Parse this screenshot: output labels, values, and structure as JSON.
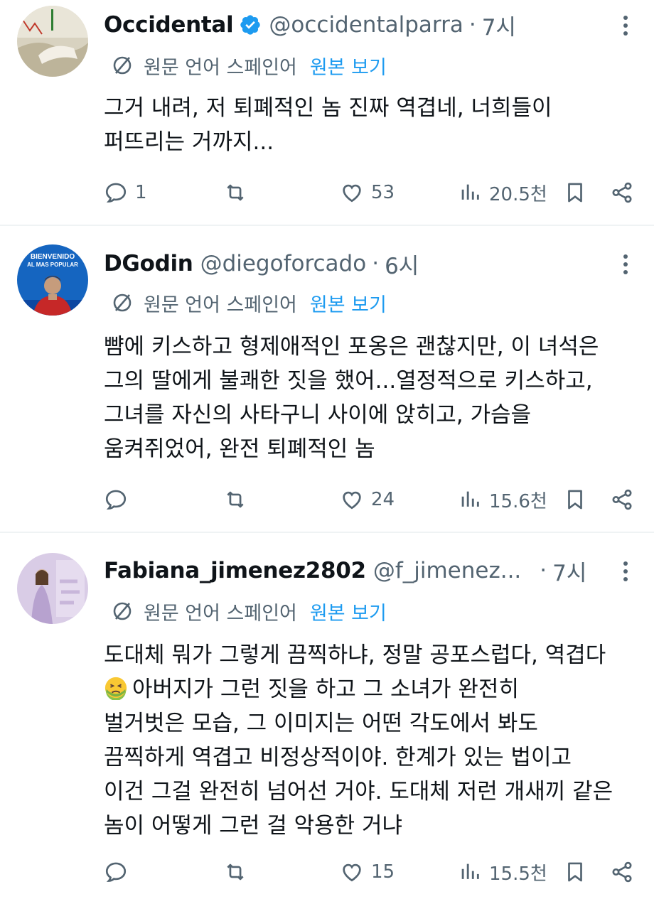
{
  "translate": {
    "label": "원문 언어 스페인어",
    "link": "원본 보기"
  },
  "tweets": [
    {
      "name": "Occidental",
      "handle": "@occidentalparra",
      "dot": "·",
      "time": "7시",
      "verified": true,
      "lines": [
        "그거 내려, 저 퇴폐적인 놈 진짜 역겹네, 너희들이",
        "퍼뜨리는 거까지..."
      ],
      "replies": "1",
      "retweets": "",
      "likes": "53",
      "views": "20.5천"
    },
    {
      "name": "DGodin",
      "handle": "@diegoforcado",
      "dot": "·",
      "time": "6시",
      "verified": false,
      "avatar_text": [
        "BIENVENIDO",
        "AL MAS POPULAR"
      ],
      "lines": [
        "뺨에 키스하고 형제애적인 포옹은 괜찮지만, 이 녀석은",
        "그의 딸에게 불쾌한 짓을 했어...열정적으로 키스하고,",
        "그녀를 자신의 사타구니 사이에 앉히고, 가슴을",
        "움켜쥐었어, 완전 퇴폐적인 놈"
      ],
      "replies": "",
      "retweets": "",
      "likes": "24",
      "views": "15.6천"
    },
    {
      "name": "Fabiana_jimenez2802",
      "handle": "@f_jimenez...",
      "dot": "·",
      "time": "7시",
      "verified": false,
      "lines": [
        "도대체 뭐가 그렇게 끔찍하냐, 정말 공포스럽다, 역겹다",
        "아버지가 그런 짓을 하고 그 소녀가 완전히",
        "벌거벗은 모습, 그 이미지는 어떤 각도에서 봐도",
        "끔찍하게 역겹고 비정상적이야. 한계가 있는 법이고",
        "이건 그걸 완전히 넘어선 거야. 도대체 저런 개새끼 같은",
        "놈이 어떻게 그런 걸 악용한 거냐"
      ],
      "emoji": "nauseated-face",
      "replies": "",
      "retweets": "",
      "likes": "15",
      "views": "15.5천"
    }
  ],
  "icons": [
    "verified-badge-icon",
    "translate-icon",
    "reply-icon",
    "retweet-icon",
    "like-icon",
    "views-icon",
    "bookmark-icon",
    "share-icon",
    "more-icon"
  ],
  "colors": {
    "text": "#0f1419",
    "secondary": "#536471",
    "link": "#1d9bf0",
    "divider": "#eff3f4"
  }
}
